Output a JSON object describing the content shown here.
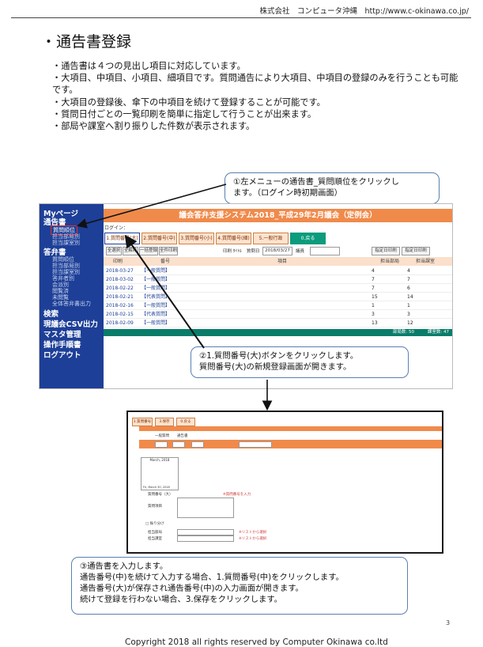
{
  "header": {
    "company": "株式会社　コンピュータ沖縄　http://www.c-okinawa.co.jp/"
  },
  "page_title": "・通告書登録",
  "bullets": [
    "・通告書は４つの見出し項目に対応しています。",
    "・大項目、中項目、小項目、細項目です。質問通告により大項目、中項目の登録のみを行うことも可能です。",
    "・大項目の登録後、傘下の中項目を続けて登録することが可能です。",
    "・質問日付ごとの一覧印刷を簡単に指定して行うことが出来ます。",
    "・部局や課室へ割り振りした件数が表示されます。"
  ],
  "callout1": {
    "line1": "①左メニューの通告書_質問順位をクリックし",
    "line2": "ます。（ログイン時初期画面）"
  },
  "callout2": {
    "line1": "②1.質問番号(大)ボタンをクリックします。",
    "line2": "質問番号(大)の新規登録画面が開きます。"
  },
  "callout3": {
    "line1": "③通告書を入力します。",
    "line2": "通告番号(中)を続けて入力する場合、1.質問番号(中)をクリックします。",
    "line3": "通告番号(大)が保存され通告番号(中)の入力画面が開きます。",
    "line4": "続けて登録を行わない場合、3.保存をクリックします。"
  },
  "shot1": {
    "system_title": "議会答弁支援システム2018_平成29年2月議会（定例会）",
    "login": "ログイン：",
    "sidebar": {
      "mypage": "Myページ",
      "tsukoku": "通告書",
      "tsukoku_items": [
        "質問順位",
        "担当部局別",
        "担当課室別"
      ],
      "toben": "答弁書",
      "toben_items": [
        "質問順位",
        "担当部局別",
        "担当課室別",
        "答弁者別",
        "会派別",
        "閲覧済",
        "未閲覧",
        "全体答弁書出力"
      ],
      "kensaku": "検索",
      "csv": "現議会CSV出力",
      "master": "マスタ管理",
      "manual": "操作手順書",
      "logout": "ログアウト"
    },
    "tabs": [
      "1.質問番号(大)",
      "2.質問番号(中)",
      "3.質問番号(小)",
      "4.質問番号(細)",
      "5.一般行政",
      "0.戻る"
    ],
    "controls": {
      "btns": [
        "全選択",
        "全解除",
        "一括登録",
        "全件印刷"
      ],
      "print_label": "印刷 ﾀｲﾄﾙ",
      "date_label": "質問日",
      "date_value": "2018/03/27",
      "dept_label": "議員",
      "right_btns": [
        "指定日印刷",
        "指定日印刷"
      ]
    },
    "columns": [
      "印刷",
      "番号",
      "項目",
      "担当部局",
      "担当課室"
    ],
    "rows": [
      {
        "date": "2018-03-27",
        "type": "【一般質問】",
        "a": "4",
        "b": "4"
      },
      {
        "date": "2018-03-02",
        "type": "【一般質問】",
        "a": "7",
        "b": "7"
      },
      {
        "date": "2018-02-22",
        "type": "【一般質問】",
        "a": "7",
        "b": "6"
      },
      {
        "date": "2018-02-21",
        "type": "【代表質問】",
        "a": "15",
        "b": "14"
      },
      {
        "date": "2018-02-16",
        "type": "【一般質問】",
        "a": "1",
        "b": "1"
      },
      {
        "date": "2018-02-15",
        "type": "【代表質問】",
        "a": "3",
        "b": "3"
      },
      {
        "date": "2018-02-09",
        "type": "【一般質問】",
        "a": "13",
        "b": "12"
      }
    ],
    "footer": {
      "left": "部局数: 50",
      "right": "課室数: 47"
    }
  },
  "shot2": {
    "tabs": [
      "1.質問番号(中)",
      "3.保存",
      "0.戻る"
    ],
    "label_top": "一般質問",
    "label_dropdown": "通告書",
    "calendar_title": "March, 2018",
    "calendar_footer": "Fri, March 30, 2018",
    "qtype_label": "質問番号（大）",
    "content_label": "質問項目",
    "required": "※質問番号を入力",
    "dept_label": "担当部局",
    "sect_label": "担当課室",
    "leaf_check": "□ 振り分け",
    "list_select": "※リストから選択"
  },
  "page_number": "3",
  "copyright": "Copyright 2018  all rights reserved by Computer Okinawa co.ltd"
}
